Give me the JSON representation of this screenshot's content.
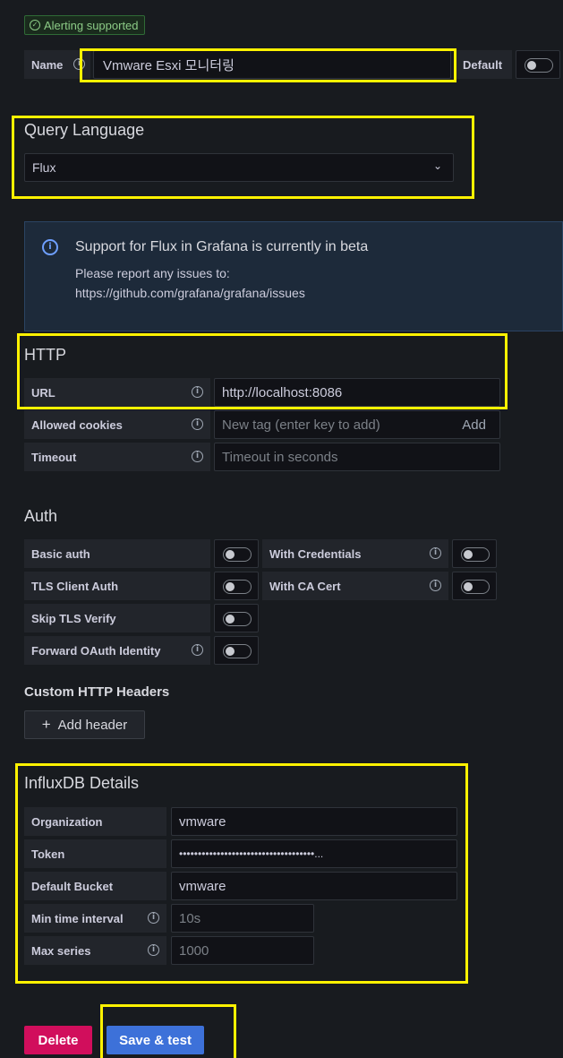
{
  "alert_badge": "Alerting supported",
  "name_row": {
    "label": "Name",
    "value": "Vmware Esxi 모니터링",
    "default_label": "Default"
  },
  "query_language": {
    "title": "Query Language",
    "selected": "Flux"
  },
  "info_banner": {
    "title": "Support for Flux in Grafana is currently in beta",
    "line1": "Please report any issues to:",
    "line2": "https://github.com/grafana/grafana/issues"
  },
  "http": {
    "title": "HTTP",
    "url_label": "URL",
    "url_value": "http://localhost:8086",
    "cookies_label": "Allowed cookies",
    "cookies_placeholder": "New tag (enter key to add)",
    "cookies_add": "Add",
    "timeout_label": "Timeout",
    "timeout_placeholder": "Timeout in seconds"
  },
  "auth": {
    "title": "Auth",
    "basic": "Basic auth",
    "with_credentials": "With Credentials",
    "tls_client": "TLS Client Auth",
    "with_ca": "With CA Cert",
    "skip_tls": "Skip TLS Verify",
    "forward_oauth": "Forward OAuth Identity"
  },
  "custom_headers": {
    "title": "Custom HTTP Headers",
    "add_label": "Add header"
  },
  "influx": {
    "title": "InfluxDB Details",
    "org_label": "Organization",
    "org_value": "vmware",
    "token_label": "Token",
    "token_value": "••••••••••••••••••••••••••••••••••••...",
    "bucket_label": "Default Bucket",
    "bucket_value": "vmware",
    "min_label": "Min time interval",
    "min_placeholder": "10s",
    "max_label": "Max series",
    "max_placeholder": "1000"
  },
  "buttons": {
    "delete": "Delete",
    "save": "Save & test"
  },
  "colors": {
    "background": "#181b1f",
    "highlight": "#fff200",
    "primary": "#3d71d9",
    "danger": "#d10e5c",
    "success": "#73bf69"
  },
  "icons": {
    "alert": "check-circle-icon",
    "info": "info-circle-icon",
    "select": "chevron-down-icon",
    "add": "plus-icon"
  }
}
